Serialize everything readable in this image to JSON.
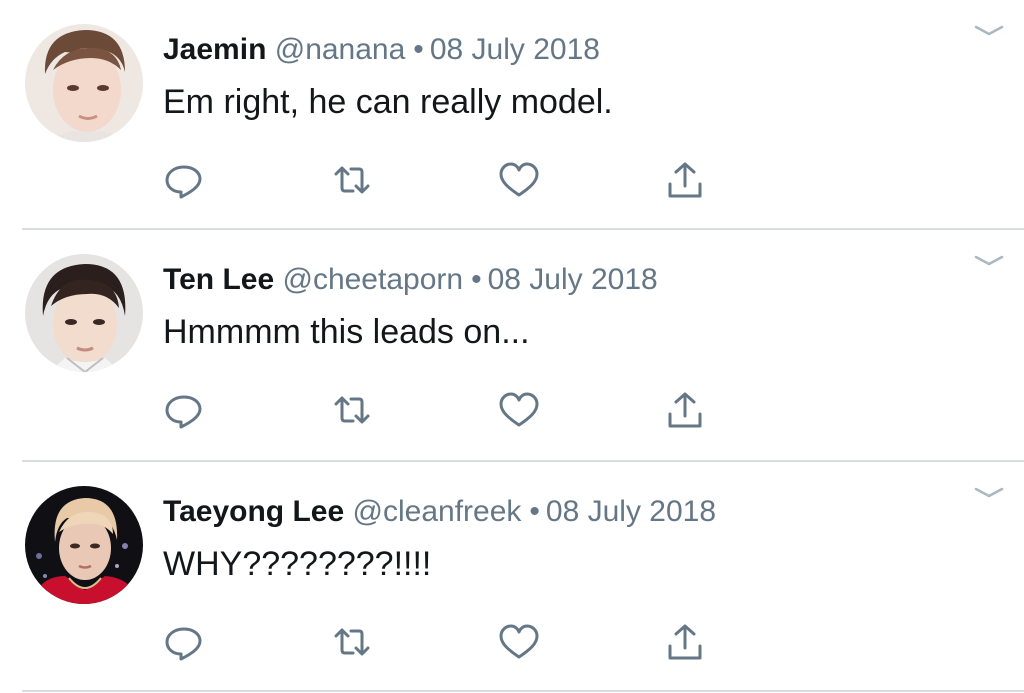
{
  "tweets": [
    {
      "name": "Jaemin",
      "handle": "@nanana",
      "separator": "•",
      "date": "08 July 2018",
      "text": "Em right, he can really model.",
      "avatar_icon": "avatar-photo",
      "actions": [
        "reply-icon",
        "retweet-icon",
        "like-icon",
        "share-icon"
      ]
    },
    {
      "name": "Ten Lee",
      "handle": "@cheetaporn",
      "separator": "•",
      "date": "08 July 2018",
      "text": "Hmmmm this leads on...",
      "avatar_icon": "avatar-photo",
      "actions": [
        "reply-icon",
        "retweet-icon",
        "like-icon",
        "share-icon"
      ]
    },
    {
      "name": "Taeyong Lee",
      "handle": "@cleanfreek",
      "separator": "•",
      "date": "08 July 2018",
      "text": "WHY????????!!!!",
      "avatar_icon": "avatar-photo",
      "actions": [
        "reply-icon",
        "retweet-icon",
        "like-icon",
        "share-icon"
      ]
    }
  ],
  "colors": {
    "text_primary": "#14171a",
    "text_secondary": "#657786",
    "icon": "#657786",
    "divider": "#d9dde1",
    "background": "#ffffff"
  }
}
